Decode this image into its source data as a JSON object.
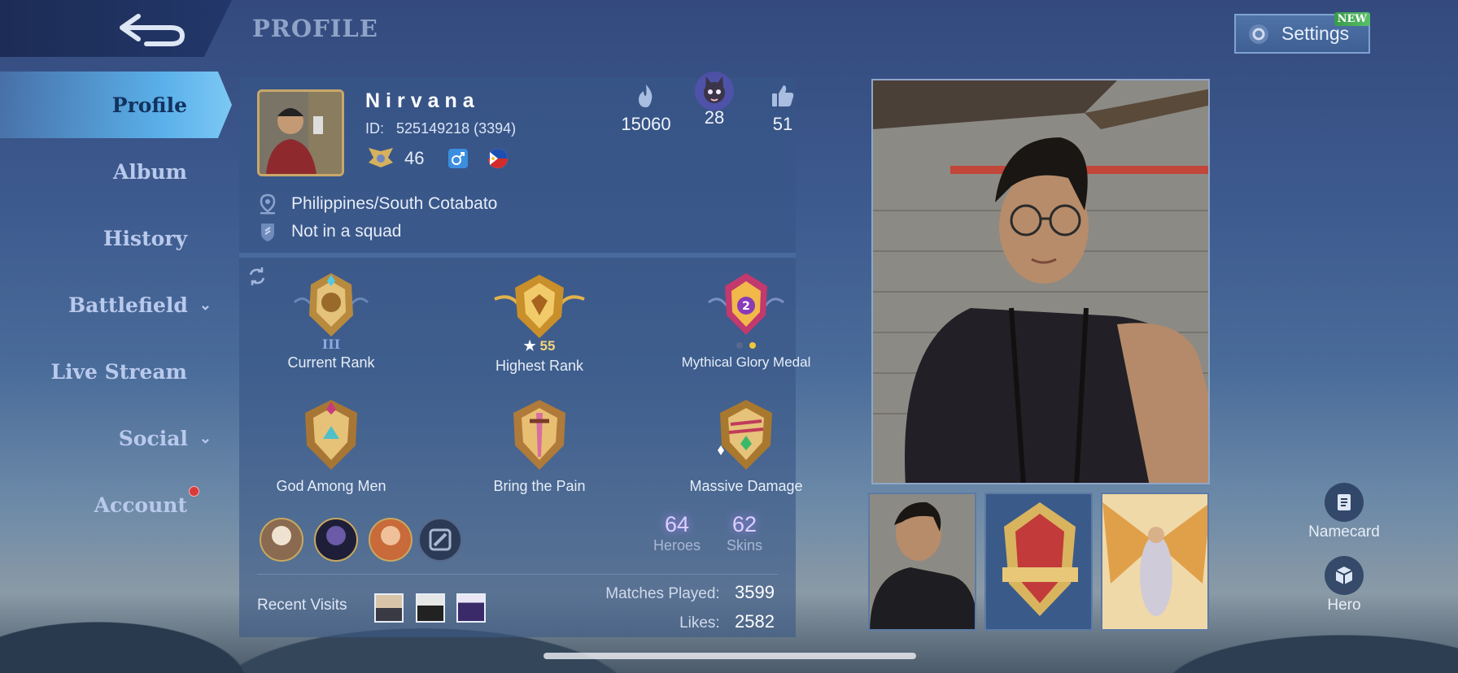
{
  "header": {
    "title": "PROFILE",
    "settings_label": "Settings",
    "settings_badge": "NEW"
  },
  "sidebar": {
    "items": [
      {
        "label": "Profile",
        "active": true
      },
      {
        "label": "Album"
      },
      {
        "label": "History"
      },
      {
        "label": "Battlefield",
        "expandable": true
      },
      {
        "label": "Live Stream"
      },
      {
        "label": "Social",
        "expandable": true
      },
      {
        "label": "Account",
        "notification": true
      }
    ]
  },
  "player": {
    "name": "Nirvana",
    "id_label": "ID:",
    "id_value": "525149218 (3394)",
    "level": "46",
    "gender_icon": "male-icon",
    "flag": "philippines-flag-icon",
    "location": "Philippines/South Cotabato",
    "squad": "Not in a squad",
    "popularity": "15060",
    "charm": "28",
    "likes_top": "51"
  },
  "badges": [
    {
      "label": "Current Rank",
      "sub": "III"
    },
    {
      "label": "Highest Rank",
      "sub": "55"
    },
    {
      "label": "Mythical Glory Medal"
    },
    {
      "label": "God Among Men"
    },
    {
      "label": "Bring the Pain"
    },
    {
      "label": "Massive Damage"
    }
  ],
  "collection": {
    "heroes": "64",
    "heroes_label": "Heroes",
    "skins": "62",
    "skins_label": "Skins"
  },
  "footer": {
    "recent_label": "Recent Visits",
    "matches_label": "Matches Played:",
    "matches_value": "3599",
    "likes_label": "Likes:",
    "likes_value": "2582"
  },
  "right_actions": {
    "namecard": "Namecard",
    "hero": "Hero"
  },
  "colors": {
    "accent": "#5ab0ea",
    "gold": "#c9a86a",
    "panel": "#3a5a8a"
  }
}
